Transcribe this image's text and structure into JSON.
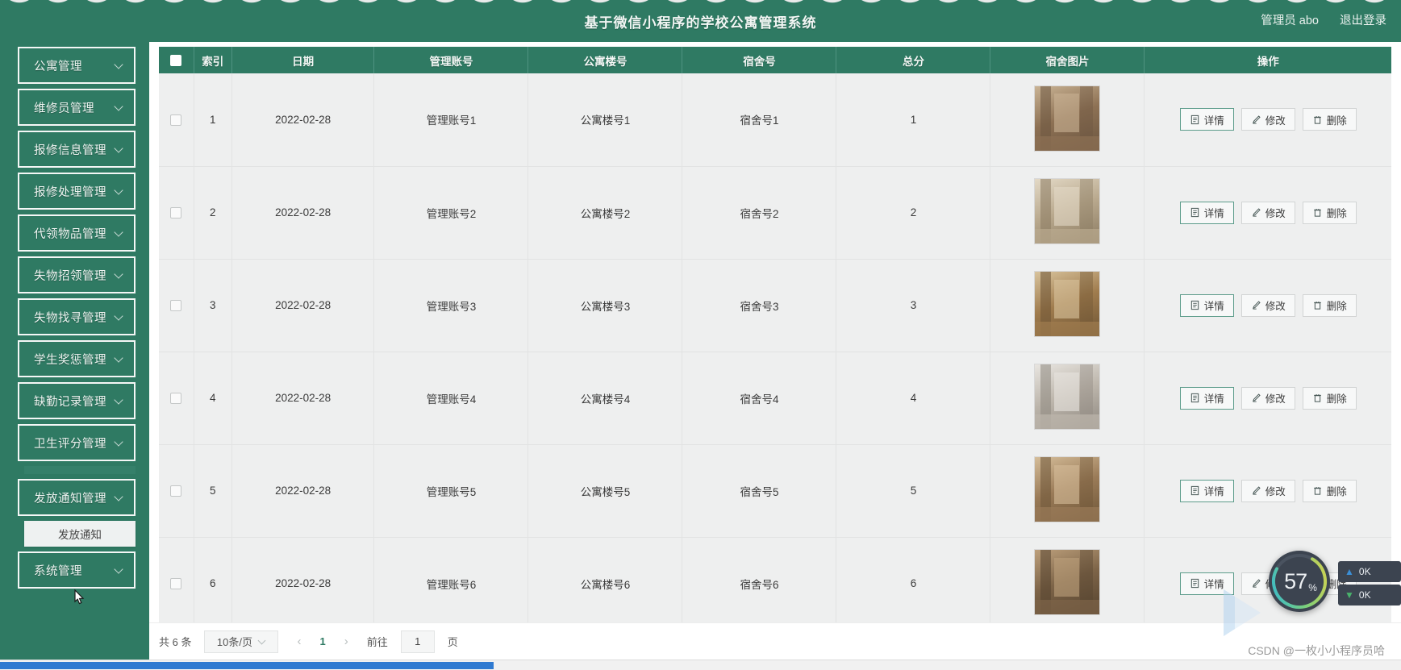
{
  "header": {
    "title": "基于微信小程序的学校公寓管理系统",
    "user": "管理员 abo",
    "logout": "退出登录"
  },
  "sidebar": {
    "items": [
      {
        "label": "公寓管理",
        "icon": "chevron-down-icon"
      },
      {
        "label": "维修员管理",
        "icon": "chevron-down-icon"
      },
      {
        "label": "报修信息管理",
        "icon": "chevron-down-icon"
      },
      {
        "label": "报修处理管理",
        "icon": "chevron-down-icon"
      },
      {
        "label": "代领物品管理",
        "icon": "chevron-down-icon"
      },
      {
        "label": "失物招领管理",
        "icon": "chevron-down-icon"
      },
      {
        "label": "失物找寻管理",
        "icon": "chevron-down-icon"
      },
      {
        "label": "学生奖惩管理",
        "icon": "chevron-down-icon"
      },
      {
        "label": "缺勤记录管理",
        "icon": "chevron-down-icon"
      },
      {
        "label": "卫生评分管理",
        "icon": "chevron-down-icon"
      },
      {
        "label": "发放通知管理",
        "icon": "chevron-down-icon"
      },
      {
        "label": "系统管理",
        "icon": "chevron-down-icon"
      }
    ],
    "submenu": {
      "label": "发放通知"
    }
  },
  "table": {
    "columns": [
      "",
      "索引",
      "日期",
      "管理账号",
      "公寓楼号",
      "宿舍号",
      "总分",
      "宿舍图片",
      "操作"
    ],
    "rows": [
      {
        "index": "1",
        "date": "2022-02-28",
        "account": "管理账号1",
        "building": "公寓楼号1",
        "dorm": "宿舍号1",
        "score": "1",
        "image": "dorm-photo-1"
      },
      {
        "index": "2",
        "date": "2022-02-28",
        "account": "管理账号2",
        "building": "公寓楼号2",
        "dorm": "宿舍号2",
        "score": "2",
        "image": "dorm-photo-2"
      },
      {
        "index": "3",
        "date": "2022-02-28",
        "account": "管理账号3",
        "building": "公寓楼号3",
        "dorm": "宿舍号3",
        "score": "3",
        "image": "dorm-photo-3"
      },
      {
        "index": "4",
        "date": "2022-02-28",
        "account": "管理账号4",
        "building": "公寓楼号4",
        "dorm": "宿舍号4",
        "score": "4",
        "image": "dorm-photo-4"
      },
      {
        "index": "5",
        "date": "2022-02-28",
        "account": "管理账号5",
        "building": "公寓楼号5",
        "dorm": "宿舍号5",
        "score": "5",
        "image": "dorm-photo-5"
      },
      {
        "index": "6",
        "date": "2022-02-28",
        "account": "管理账号6",
        "building": "公寓楼号6",
        "dorm": "宿舍号6",
        "score": "6",
        "image": "dorm-photo-6"
      }
    ],
    "actions": {
      "detail": "详情",
      "edit": "修改",
      "delete": "删除"
    }
  },
  "pagination": {
    "total": "共 6 条",
    "page_size": "10条/页",
    "prev": "‹",
    "current_page": "1",
    "next": "›",
    "goto_label": "前往",
    "goto_value": "1",
    "page_unit": "页"
  },
  "overlay": {
    "cpu_percent": "57",
    "percent_sign": "%",
    "upload": "0K",
    "download": "0K",
    "watermark": "CSDN @一枚小小程序员哈"
  },
  "colors": {
    "brand_green": "#2f7a63",
    "row_bg": "#eeefef",
    "accent_blue": "#2f7ad1"
  }
}
